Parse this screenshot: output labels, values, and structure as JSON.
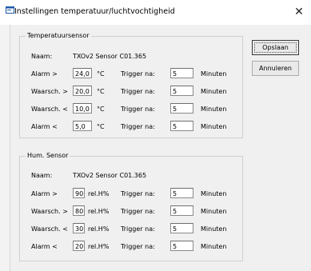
{
  "window": {
    "title": "Instellingen temperatuur/luchtvochtigheid",
    "close_glyph": "✕"
  },
  "buttons": {
    "save": "Opslaan",
    "cancel": "Annuleren"
  },
  "temperature": {
    "legend": "Temperatuursensor",
    "name_label": "Naam:",
    "name_value": "TXOv2 Sensor C01.365",
    "rows": [
      {
        "label": "Alarm >",
        "value": "24,0",
        "unit": "°C",
        "trigger_label": "Trigger na:",
        "trigger_value": "5",
        "minutes": "Minuten"
      },
      {
        "label": "Waarsch. >",
        "value": "20,0",
        "unit": "°C",
        "trigger_label": "Trigger na:",
        "trigger_value": "5",
        "minutes": "Minuten"
      },
      {
        "label": "Waarsch. <",
        "value": "10,0",
        "unit": "°C",
        "trigger_label": "Trigger na:",
        "trigger_value": "5",
        "minutes": "Minuten"
      },
      {
        "label": "Alarm <",
        "value": "5,0",
        "unit": "°C",
        "trigger_label": "Trigger na:",
        "trigger_value": "5",
        "minutes": "Minuten"
      }
    ]
  },
  "humidity": {
    "legend": "Hum. Sensor",
    "name_label": "Naam:",
    "name_value": "TXOv2 Sensor C01.365",
    "rows": [
      {
        "label": "Alarm >",
        "value": "90",
        "unit": "rel.H%",
        "trigger_label": "Trigger na:",
        "trigger_value": "5",
        "minutes": "Minuten"
      },
      {
        "label": "Waarsch. >",
        "value": "80",
        "unit": "rel.H%",
        "trigger_label": "Trigger na:",
        "trigger_value": "5",
        "minutes": "Minuten"
      },
      {
        "label": "Waarsch. <",
        "value": "30",
        "unit": "rel.H%",
        "trigger_label": "Trigger na:",
        "trigger_value": "5",
        "minutes": "Minuten"
      },
      {
        "label": "Alarm <",
        "value": "20",
        "unit": "rel.H%",
        "trigger_label": "Trigger na:",
        "trigger_value": "5",
        "minutes": "Minuten"
      }
    ]
  }
}
